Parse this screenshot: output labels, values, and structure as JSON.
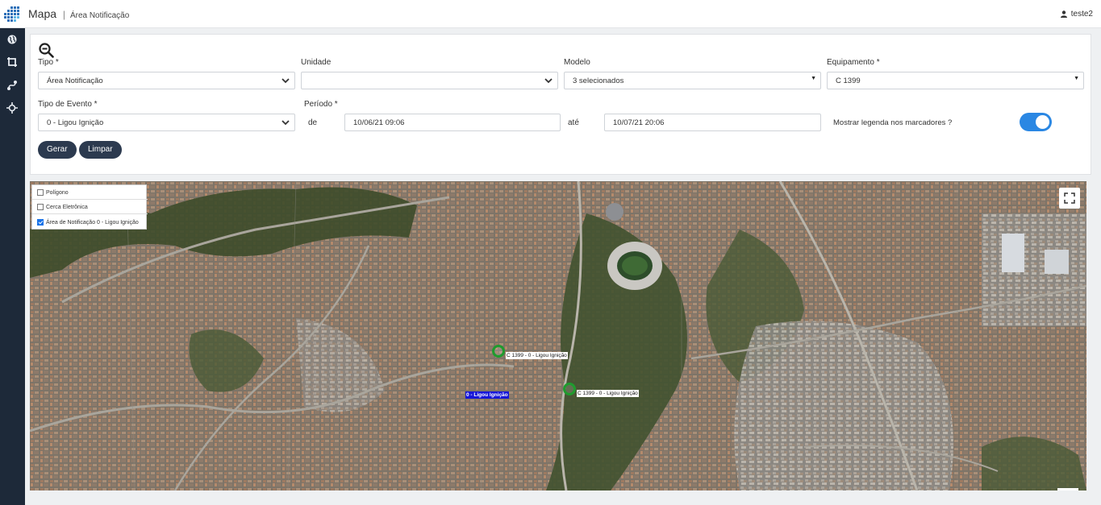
{
  "header": {
    "title": "Mapa",
    "separator": "|",
    "subtitle": "Área Notificação",
    "user": "teste2"
  },
  "sidebar": {
    "items": [
      {
        "icon": "globe-icon"
      },
      {
        "icon": "crop-icon"
      },
      {
        "icon": "route-icon"
      },
      {
        "icon": "crosshair-icon"
      }
    ]
  },
  "filters": {
    "tipo": {
      "label": "Tipo *",
      "value": "Área Notificação"
    },
    "unidade": {
      "label": "Unidade",
      "value": ""
    },
    "modelo": {
      "label": "Modelo",
      "value": "3 selecionados"
    },
    "equipamento": {
      "label": "Equipamento *",
      "value": "C 1399"
    },
    "tipo_evento": {
      "label": "Tipo de Evento *",
      "value": "0 - Ligou Ignição"
    },
    "periodo": {
      "label": "Período *",
      "de": "de",
      "ate": "até",
      "start": "10/06/21 09:06",
      "end": "10/07/21 20:06"
    },
    "legend_toggle": {
      "label": "Mostrar legenda nos marcadores ?",
      "on": true
    },
    "gerar": "Gerar",
    "limpar": "Limpar"
  },
  "map": {
    "layers": [
      {
        "label": "Polígono",
        "checked": false
      },
      {
        "label": "Cerca Eletrônica",
        "checked": false
      },
      {
        "label": "Área de Notificação 0 - Ligou Ignição",
        "checked": true
      }
    ],
    "markers": [
      {
        "label": "C 1399 - 0 - Ligou Ignição"
      },
      {
        "label": "C 1399 - 0 - Ligou Ignição"
      }
    ],
    "area_label": "0 - Ligou Ignição"
  },
  "colors": {
    "sidebar": "#1d2939",
    "button": "#2c3a4f",
    "toggle": "#2a87e3",
    "marker": "#1f9b2e",
    "area_label_bg": "#1616d8"
  }
}
